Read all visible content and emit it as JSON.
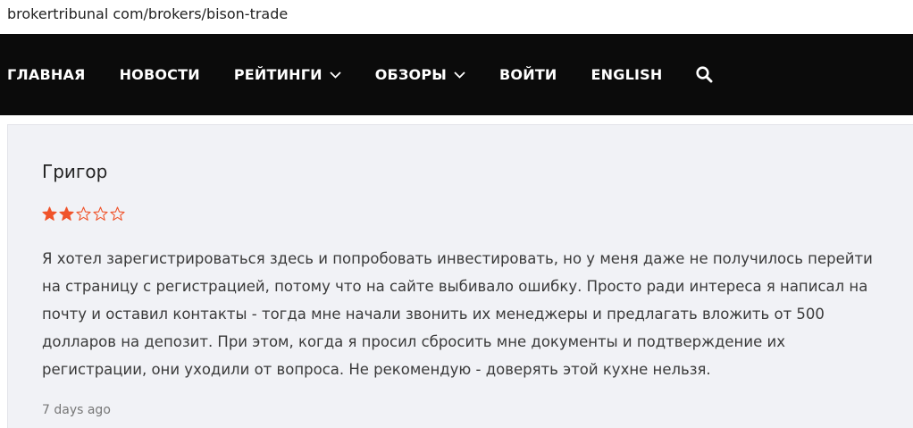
{
  "url": "brokertribunal com/brokers/bison-trade",
  "nav": {
    "items": [
      {
        "label": "ГЛАВНАЯ",
        "dropdown": false
      },
      {
        "label": "НОВОСТИ",
        "dropdown": false
      },
      {
        "label": "РЕЙТИНГИ",
        "dropdown": true
      },
      {
        "label": "ОБЗОРЫ",
        "dropdown": true
      },
      {
        "label": "ВОЙТИ",
        "dropdown": false
      },
      {
        "label": "ENGLISH",
        "dropdown": false
      }
    ],
    "search_icon": "search-icon"
  },
  "review": {
    "author": "Григор",
    "rating": 2,
    "max_rating": 5,
    "star_color": "#f0532a",
    "text": "Я хотел зарегистрироваться здесь и попробовать инвестировать, но у меня даже не получилось перейти на страницу с регистрацией, потому что на сайте выбивало ошибку. Просто ради интереса я написал на почту и оставил контакты - тогда мне начали звонить их менеджеры и предлагать вложить от 500 долларов на депозит. При этом, когда я просил сбросить мне документы и подтверждение их регистрации, они уходили от вопроса. Не рекомендую - доверять этой кухне нельзя.",
    "date": "7 days ago"
  }
}
